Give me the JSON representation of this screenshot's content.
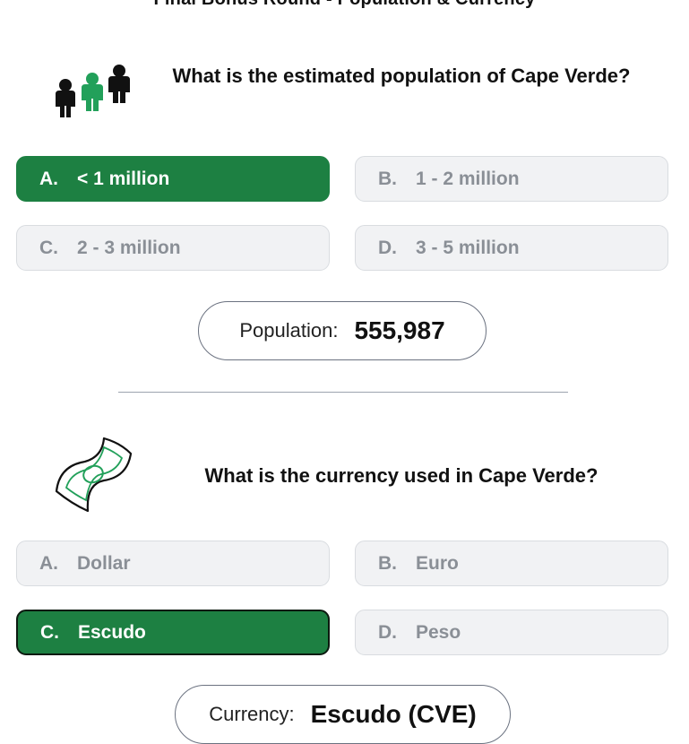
{
  "title": "Final Bonus Round - Population & Currency",
  "colors": {
    "selected": "#1d8042",
    "option_bg": "#f1f2f4",
    "option_text": "#8a8f96",
    "icon_green": "#22a05a"
  },
  "q1": {
    "icon": "people-icon",
    "question": "What is the estimated population of Cape Verde?",
    "options": [
      {
        "letter": "A.",
        "text": "< 1 million",
        "selected": true
      },
      {
        "letter": "B.",
        "text": "1 - 2 million",
        "selected": false
      },
      {
        "letter": "C.",
        "text": "2 - 3 million",
        "selected": false
      },
      {
        "letter": "D.",
        "text": "3 - 5 million",
        "selected": false
      }
    ],
    "answer_label": "Population:",
    "answer_value": "555,987"
  },
  "q2": {
    "icon": "banknote-icon",
    "question": "What is the currency used in Cape Verde?",
    "options": [
      {
        "letter": "A.",
        "text": "Dollar",
        "selected": false
      },
      {
        "letter": "B.",
        "text": "Euro",
        "selected": false
      },
      {
        "letter": "C.",
        "text": "Escudo",
        "selected": true
      },
      {
        "letter": "D.",
        "text": "Peso",
        "selected": false
      }
    ],
    "answer_label": "Currency:",
    "answer_value": "Escudo (CVE)"
  }
}
